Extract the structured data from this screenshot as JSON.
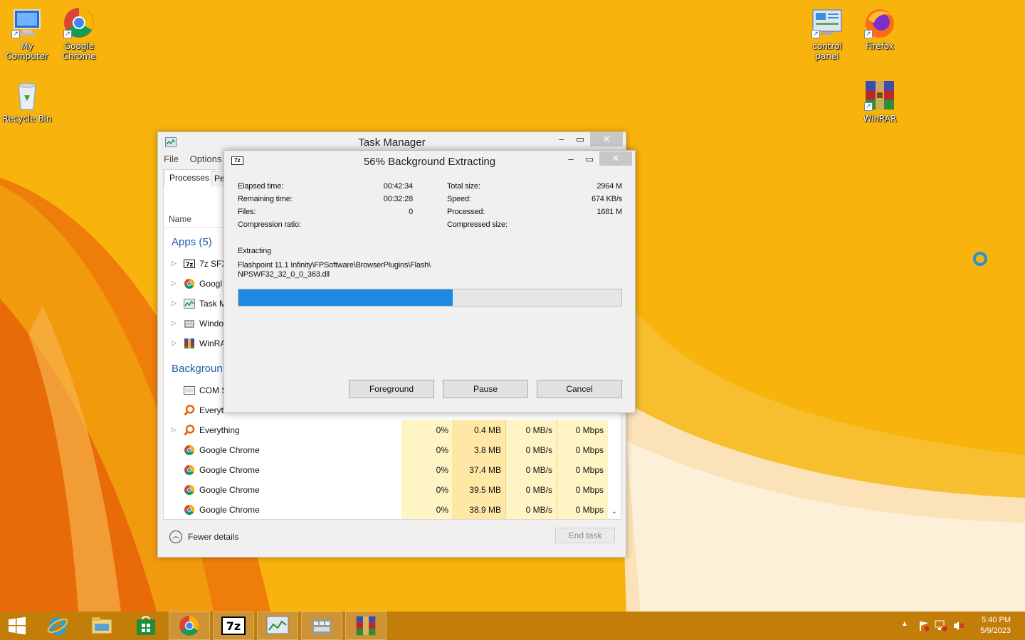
{
  "desktop": {
    "icons": [
      {
        "label": "My Computer"
      },
      {
        "label": "Google Chrome"
      },
      {
        "label": "Recycle Bin"
      },
      {
        "label": "control panel"
      },
      {
        "label": "Firefox"
      },
      {
        "label": "WinRAR"
      }
    ]
  },
  "task_manager": {
    "title": "Task Manager",
    "menu": [
      "File",
      "Options"
    ],
    "tabs": [
      "Processes",
      "Pe"
    ],
    "column_name": "Name",
    "groups": {
      "apps": "Apps (5)",
      "background": "Backgroun"
    },
    "apps": [
      {
        "name": "7z SFX",
        "icon": "7z-icon"
      },
      {
        "name": "Googl",
        "icon": "chrome-icon"
      },
      {
        "name": "Task M",
        "icon": "task-manager-icon"
      },
      {
        "name": "Windo",
        "icon": "explorer-icon"
      },
      {
        "name": "WinRA",
        "icon": "winrar-icon"
      }
    ],
    "background": [
      {
        "name": "COM S",
        "icon": "com-surrogate-icon"
      },
      {
        "name": "Everyt",
        "icon": "everything-icon"
      }
    ],
    "rows": [
      {
        "name": "Everything",
        "icon": "everything-icon",
        "expandable": true,
        "cpu": "0%",
        "memory": "0.4 MB",
        "disk": "0 MB/s",
        "network": "0 Mbps"
      },
      {
        "name": "Google Chrome",
        "icon": "chrome-icon",
        "expandable": false,
        "cpu": "0%",
        "memory": "3.8 MB",
        "disk": "0 MB/s",
        "network": "0 Mbps"
      },
      {
        "name": "Google Chrome",
        "icon": "chrome-icon",
        "expandable": false,
        "cpu": "0%",
        "memory": "37.4 MB",
        "disk": "0 MB/s",
        "network": "0 Mbps"
      },
      {
        "name": "Google Chrome",
        "icon": "chrome-icon",
        "expandable": false,
        "cpu": "0%",
        "memory": "39.5 MB",
        "disk": "0 MB/s",
        "network": "0 Mbps"
      },
      {
        "name": "Google Chrome",
        "icon": "chrome-icon",
        "expandable": false,
        "cpu": "0%",
        "memory": "38.9 MB",
        "disk": "0 MB/s",
        "network": "0 Mbps"
      }
    ],
    "fewer_details": "Fewer details",
    "end_task": "End task"
  },
  "extract_dialog": {
    "title": "56% Background Extracting",
    "progress_percent": 56,
    "left_stats": [
      {
        "label": "Elapsed time:",
        "value": "00:42:34"
      },
      {
        "label": "Remaining time:",
        "value": "00:32:28"
      },
      {
        "label": "Files:",
        "value": "0"
      },
      {
        "label": "Compression ratio:",
        "value": ""
      }
    ],
    "right_stats": [
      {
        "label": "Total size:",
        "value": "2964 M"
      },
      {
        "label": "Speed:",
        "value": "674 KB/s"
      },
      {
        "label": "Processed:",
        "value": "1681 M"
      },
      {
        "label": "Compressed size:",
        "value": ""
      }
    ],
    "status": "Extracting",
    "path_line1": "Flashpoint 11.1 Infinity\\FPSoftware\\BrowserPlugins\\Flash\\",
    "path_line2": "NPSWF32_32_0_0_363.dll",
    "buttons": {
      "foreground": "Foreground",
      "pause": "Pause",
      "cancel": "Cancel"
    },
    "colors": {
      "progress": "#1e88e5"
    }
  },
  "taskbar": {
    "items": [
      "start-icon",
      "internet-explorer-icon",
      "file-explorer-icon",
      "store-icon",
      "chrome-icon",
      "7zip-icon",
      "task-manager-icon",
      "explorer-window-icon",
      "winrar-icon"
    ],
    "clock": {
      "time": "5:40 PM",
      "date": "5/9/2023"
    }
  }
}
